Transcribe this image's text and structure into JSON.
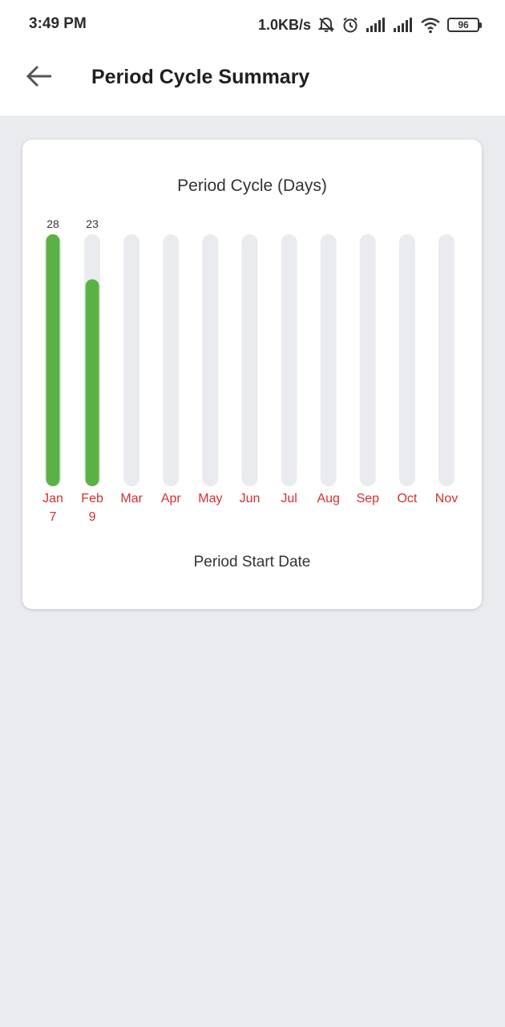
{
  "status_bar": {
    "time": "3:49 PM",
    "net_speed": "1.0KB/s",
    "battery": "96",
    "icons": [
      "bell-off-icon",
      "alarm-icon",
      "signal-icon",
      "signal-icon",
      "wifi-icon",
      "battery-icon"
    ]
  },
  "app_bar": {
    "back_icon": "arrow-left-icon",
    "title": "Period Cycle Summary"
  },
  "colors": {
    "bar_fill": "#5bb244",
    "bar_track": "#eaebef",
    "month_label": "#d32f2f",
    "background": "#eaebef"
  },
  "chart_data": {
    "type": "bar",
    "title": "Period Cycle (Days)",
    "xlabel": "Period Start Date",
    "ylabel": "",
    "ylim": [
      0,
      28
    ],
    "categories": [
      [
        "Jan",
        "7"
      ],
      [
        "Feb",
        "9"
      ],
      [
        "Mar",
        ""
      ],
      [
        "Apr",
        ""
      ],
      [
        "May",
        ""
      ],
      [
        "Jun",
        ""
      ],
      [
        "Jul",
        ""
      ],
      [
        "Aug",
        ""
      ],
      [
        "Sep",
        ""
      ],
      [
        "Oct",
        ""
      ],
      [
        "Nov",
        ""
      ]
    ],
    "values": [
      28,
      23,
      null,
      null,
      null,
      null,
      null,
      null,
      null,
      null,
      null
    ],
    "data_labels": [
      "28",
      "23",
      "",
      "",
      "",
      "",
      "",
      "",
      "",
      "",
      ""
    ],
    "grid": false,
    "legend": "none"
  }
}
